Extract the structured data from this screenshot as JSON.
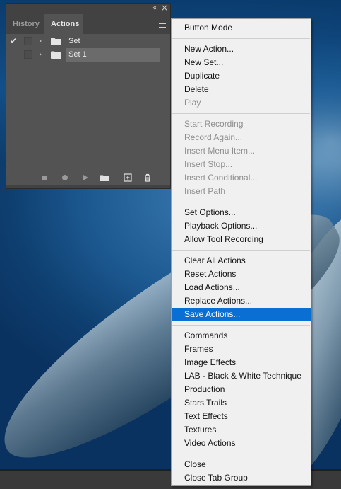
{
  "panel": {
    "tabs": [
      {
        "label": "History"
      },
      {
        "label": "Actions"
      }
    ],
    "rows": [
      {
        "label": "Set",
        "checked": true
      },
      {
        "label": "Set 1",
        "checked": false
      }
    ],
    "icons": {
      "collapse": "«",
      "close": "×",
      "check": "✔",
      "chevron": "›"
    }
  },
  "menu": {
    "groups": [
      [
        {
          "label": "Button Mode",
          "enabled": true
        }
      ],
      [
        {
          "label": "New Action...",
          "enabled": true
        },
        {
          "label": "New Set...",
          "enabled": true
        },
        {
          "label": "Duplicate",
          "enabled": true
        },
        {
          "label": "Delete",
          "enabled": true
        },
        {
          "label": "Play",
          "enabled": false
        }
      ],
      [
        {
          "label": "Start Recording",
          "enabled": false
        },
        {
          "label": "Record Again...",
          "enabled": false
        },
        {
          "label": "Insert Menu Item...",
          "enabled": false
        },
        {
          "label": "Insert Stop...",
          "enabled": false
        },
        {
          "label": "Insert Conditional...",
          "enabled": false
        },
        {
          "label": "Insert Path",
          "enabled": false
        }
      ],
      [
        {
          "label": "Set Options...",
          "enabled": true
        },
        {
          "label": "Playback Options...",
          "enabled": true
        },
        {
          "label": "Allow Tool Recording",
          "enabled": true
        }
      ],
      [
        {
          "label": "Clear All Actions",
          "enabled": true
        },
        {
          "label": "Reset Actions",
          "enabled": true
        },
        {
          "label": "Load Actions...",
          "enabled": true
        },
        {
          "label": "Replace Actions...",
          "enabled": true
        },
        {
          "label": "Save Actions...",
          "enabled": true,
          "highlighted": true
        }
      ],
      [
        {
          "label": "Commands",
          "enabled": true
        },
        {
          "label": "Frames",
          "enabled": true
        },
        {
          "label": "Image Effects",
          "enabled": true
        },
        {
          "label": "LAB - Black & White Technique",
          "enabled": true
        },
        {
          "label": "Production",
          "enabled": true
        },
        {
          "label": "Stars Trails",
          "enabled": true
        },
        {
          "label": "Text Effects",
          "enabled": true
        },
        {
          "label": "Textures",
          "enabled": true
        },
        {
          "label": "Video Actions",
          "enabled": true
        }
      ],
      [
        {
          "label": "Close",
          "enabled": true
        },
        {
          "label": "Close Tab Group",
          "enabled": true
        }
      ]
    ]
  },
  "colors": {
    "highlight": "#0a6fd3",
    "panel_bg": "#535353",
    "menu_bg": "#f0f0f0"
  }
}
